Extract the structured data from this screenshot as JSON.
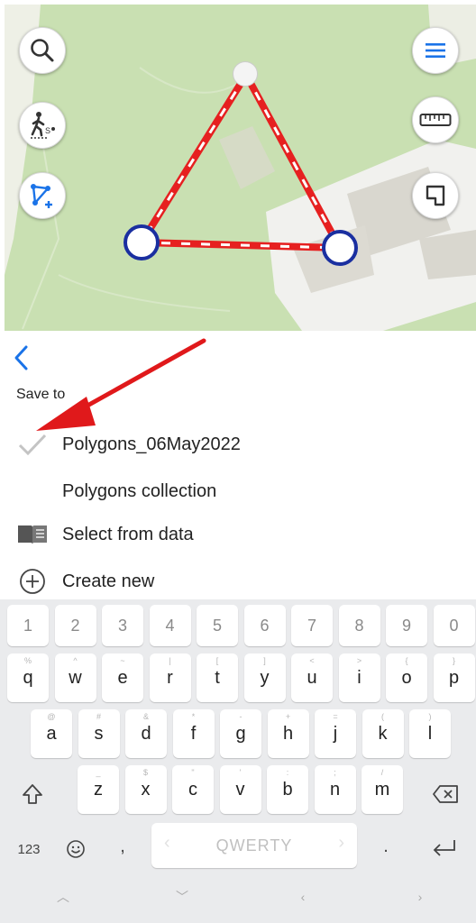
{
  "panel": {
    "save_to_label": "Save to",
    "items": [
      {
        "label": "Polygons_06May2022",
        "icon": "check-icon"
      },
      {
        "label": "Polygons collection",
        "icon": ""
      },
      {
        "label": "Select from data",
        "icon": "book-icon"
      },
      {
        "label": "Create new",
        "icon": "plus-circle-icon"
      }
    ]
  },
  "map": {
    "buttons_left": [
      "search-icon",
      "walk-measure-icon",
      "draw-polygon-icon"
    ],
    "buttons_right": [
      "menu-icon",
      "ruler-icon",
      "area-icon"
    ],
    "polygon_color": "#e62020",
    "vertex_color": "#1a2fa0"
  },
  "keyboard": {
    "number_row": [
      "1",
      "2",
      "3",
      "4",
      "5",
      "6",
      "7",
      "8",
      "9",
      "0"
    ],
    "row1": [
      {
        "k": "q",
        "h": "%"
      },
      {
        "k": "w",
        "h": "^"
      },
      {
        "k": "e",
        "h": "~"
      },
      {
        "k": "r",
        "h": "|"
      },
      {
        "k": "t",
        "h": "["
      },
      {
        "k": "y",
        "h": "]"
      },
      {
        "k": "u",
        "h": "<"
      },
      {
        "k": "i",
        "h": ">"
      },
      {
        "k": "o",
        "h": "{"
      },
      {
        "k": "p",
        "h": "}"
      }
    ],
    "row2": [
      {
        "k": "a",
        "h": "@"
      },
      {
        "k": "s",
        "h": "#"
      },
      {
        "k": "d",
        "h": "&"
      },
      {
        "k": "f",
        "h": "*"
      },
      {
        "k": "g",
        "h": "-"
      },
      {
        "k": "h",
        "h": "+"
      },
      {
        "k": "j",
        "h": "="
      },
      {
        "k": "k",
        "h": "("
      },
      {
        "k": "l",
        "h": ")"
      }
    ],
    "row3": [
      {
        "k": "z",
        "h": "_"
      },
      {
        "k": "x",
        "h": "$"
      },
      {
        "k": "c",
        "h": "\""
      },
      {
        "k": "v",
        "h": "'"
      },
      {
        "k": "b",
        "h": ":"
      },
      {
        "k": "n",
        "h": ";"
      },
      {
        "k": "m",
        "h": "/"
      }
    ],
    "symbols_label": "123",
    "comma": ",",
    "period": ".",
    "space_label": "QWERTY"
  },
  "accent_color": "#1a73e8",
  "arrow_color": "#e0191b"
}
